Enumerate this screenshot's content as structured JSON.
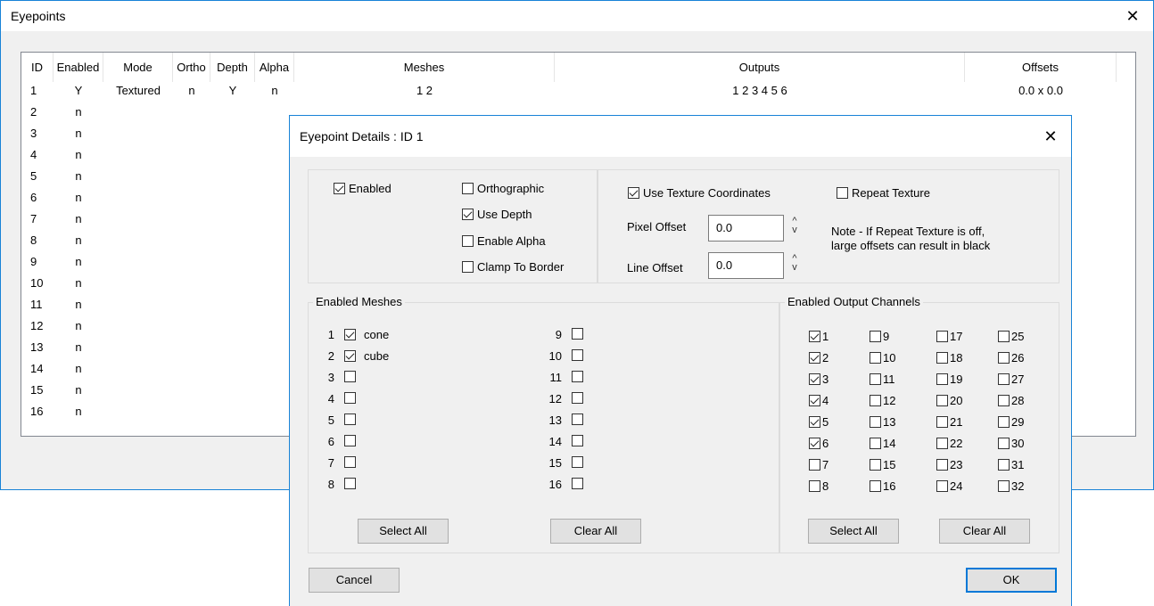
{
  "main": {
    "title": "Eyepoints",
    "close": "✕",
    "columns": [
      "ID",
      "Enabled",
      "Mode",
      "Ortho",
      "Depth",
      "Alpha",
      "Meshes",
      "Outputs",
      "Offsets"
    ],
    "rows": [
      {
        "id": "1",
        "enabled": "Y",
        "mode": "Textured",
        "ortho": "n",
        "depth": "Y",
        "alpha": "n",
        "meshes": "1 2",
        "outputs": "1 2 3 4 5 6",
        "offsets": "0.0 x 0.0"
      },
      {
        "id": "2",
        "enabled": "n"
      },
      {
        "id": "3",
        "enabled": "n"
      },
      {
        "id": "4",
        "enabled": "n"
      },
      {
        "id": "5",
        "enabled": "n"
      },
      {
        "id": "6",
        "enabled": "n"
      },
      {
        "id": "7",
        "enabled": "n"
      },
      {
        "id": "8",
        "enabled": "n"
      },
      {
        "id": "9",
        "enabled": "n"
      },
      {
        "id": "10",
        "enabled": "n"
      },
      {
        "id": "11",
        "enabled": "n"
      },
      {
        "id": "12",
        "enabled": "n"
      },
      {
        "id": "13",
        "enabled": "n"
      },
      {
        "id": "14",
        "enabled": "n"
      },
      {
        "id": "15",
        "enabled": "n"
      },
      {
        "id": "16",
        "enabled": "n"
      }
    ]
  },
  "dialog": {
    "title": "Eyepoint Details : ID 1",
    "close": "✕",
    "options": {
      "enabled": {
        "label": "Enabled",
        "checked": true
      },
      "orthographic": {
        "label": "Orthographic",
        "checked": false
      },
      "use_depth": {
        "label": "Use Depth",
        "checked": true
      },
      "enable_alpha": {
        "label": "Enable Alpha",
        "checked": false
      },
      "clamp_to_border": {
        "label": "Clamp To Border",
        "checked": false
      }
    },
    "texture": {
      "use_coords": {
        "label": "Use Texture Coordinates",
        "checked": true
      },
      "repeat": {
        "label": "Repeat Texture",
        "checked": false
      },
      "pixel_offset_label": "Pixel Offset",
      "pixel_offset_value": "0.0",
      "line_offset_label": "Line Offset",
      "line_offset_value": "0.0",
      "spin_up": "^",
      "spin_down": "v",
      "note_line1": "Note - If Repeat Texture is off,",
      "note_line2": "large offsets can result in black"
    },
    "meshes": {
      "title": "Enabled Meshes",
      "items": [
        {
          "num": "1",
          "label": "cone",
          "checked": true
        },
        {
          "num": "2",
          "label": "cube",
          "checked": true
        },
        {
          "num": "3",
          "label": "",
          "checked": false
        },
        {
          "num": "4",
          "label": "",
          "checked": false
        },
        {
          "num": "5",
          "label": "",
          "checked": false
        },
        {
          "num": "6",
          "label": "",
          "checked": false
        },
        {
          "num": "7",
          "label": "",
          "checked": false
        },
        {
          "num": "8",
          "label": "",
          "checked": false
        },
        {
          "num": "9",
          "label": "",
          "checked": false
        },
        {
          "num": "10",
          "label": "",
          "checked": false
        },
        {
          "num": "11",
          "label": "",
          "checked": false
        },
        {
          "num": "12",
          "label": "",
          "checked": false
        },
        {
          "num": "13",
          "label": "",
          "checked": false
        },
        {
          "num": "14",
          "label": "",
          "checked": false
        },
        {
          "num": "15",
          "label": "",
          "checked": false
        },
        {
          "num": "16",
          "label": "",
          "checked": false
        }
      ],
      "select_all": "Select All",
      "clear_all": "Clear All"
    },
    "outputs": {
      "title": "Enabled Output Channels",
      "channels": [
        {
          "label": "1",
          "checked": true
        },
        {
          "label": "2",
          "checked": true
        },
        {
          "label": "3",
          "checked": true
        },
        {
          "label": "4",
          "checked": true
        },
        {
          "label": "5",
          "checked": true
        },
        {
          "label": "6",
          "checked": true
        },
        {
          "label": "7",
          "checked": false
        },
        {
          "label": "8",
          "checked": false
        },
        {
          "label": "9",
          "checked": false
        },
        {
          "label": "10",
          "checked": false
        },
        {
          "label": "11",
          "checked": false
        },
        {
          "label": "12",
          "checked": false
        },
        {
          "label": "13",
          "checked": false
        },
        {
          "label": "14",
          "checked": false
        },
        {
          "label": "15",
          "checked": false
        },
        {
          "label": "16",
          "checked": false
        },
        {
          "label": "17",
          "checked": false
        },
        {
          "label": "18",
          "checked": false
        },
        {
          "label": "19",
          "checked": false
        },
        {
          "label": "20",
          "checked": false
        },
        {
          "label": "21",
          "checked": false
        },
        {
          "label": "22",
          "checked": false
        },
        {
          "label": "23",
          "checked": false
        },
        {
          "label": "24",
          "checked": false
        },
        {
          "label": "25",
          "checked": false
        },
        {
          "label": "26",
          "checked": false
        },
        {
          "label": "27",
          "checked": false
        },
        {
          "label": "28",
          "checked": false
        },
        {
          "label": "29",
          "checked": false
        },
        {
          "label": "30",
          "checked": false
        },
        {
          "label": "31",
          "checked": false
        },
        {
          "label": "32",
          "checked": false
        }
      ],
      "select_all": "Select All",
      "clear_all": "Clear All"
    },
    "cancel": "Cancel",
    "ok": "OK"
  }
}
